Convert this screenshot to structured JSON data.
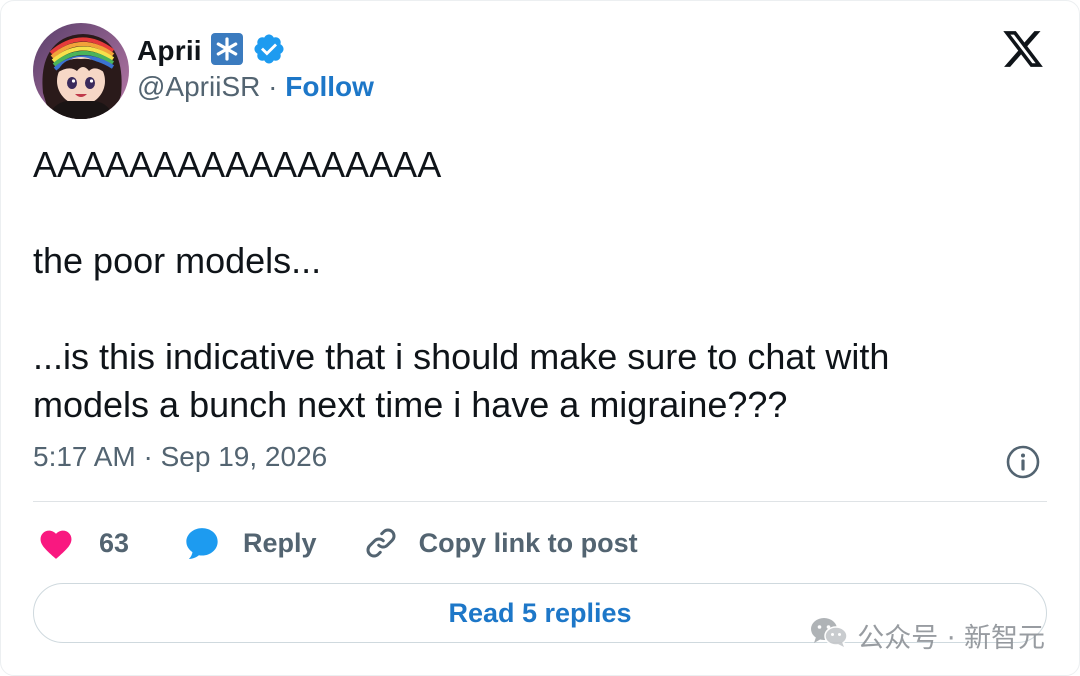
{
  "author": {
    "display_name": "Aprii",
    "handle": "@ApriiSR",
    "separator": " · ",
    "follow_label": "Follow",
    "badge_icon": "asterisk-badge-icon",
    "verified_icon": "verified-badge-icon"
  },
  "tweet": {
    "text": "AAAAAAAAAAAAAAAAA\n\nthe poor models...\n\n...is this indicative that i should make sure to chat with\nmodels a bunch next time i have a migraine???",
    "time": "5:17 AM",
    "date_separator": " · ",
    "date": "Sep 19, 2026"
  },
  "actions": {
    "like_count": "63",
    "reply_label": "Reply",
    "copy_link_label": "Copy link to post"
  },
  "read_replies_label": "Read 5 replies",
  "watermark": {
    "text": "公众号 · 新智元"
  },
  "colors": {
    "like": "#f91880",
    "reply": "#1d9bf0",
    "link": "#1d77c8",
    "secondary_text": "#536471",
    "badge_blue": "#1d9bf0",
    "asterisk_badge_bg": "#3b7bbf"
  }
}
